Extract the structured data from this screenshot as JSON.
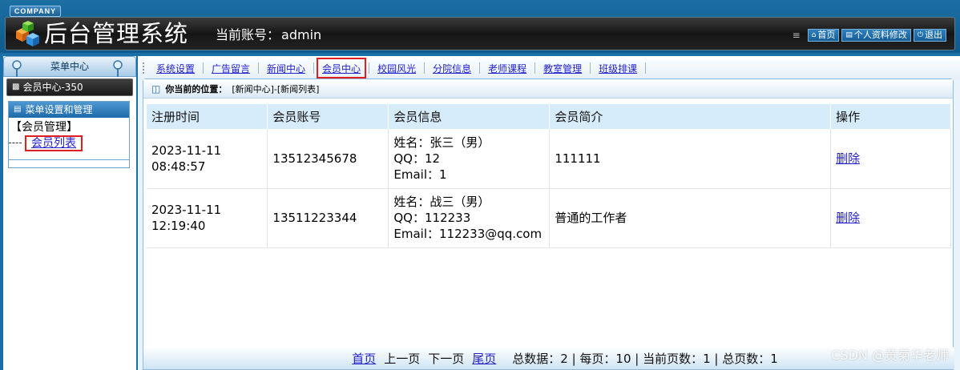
{
  "header": {
    "company": "COMPANY",
    "title": "后台管理系统",
    "account_label": "当前账号：",
    "account_value": "admin",
    "menu": [
      {
        "label": "首页",
        "icon": "home-icon"
      },
      {
        "label": "个人资料修改",
        "icon": "profile-icon"
      },
      {
        "label": "退出",
        "icon": "power-icon"
      }
    ]
  },
  "sidebar": {
    "title": "菜单中心",
    "group": "会员中心-350",
    "box_title": "菜单设置和管理",
    "category": "【会员管理】",
    "link": "会员列表"
  },
  "tabs": [
    {
      "label": "系统设置",
      "active": false
    },
    {
      "label": "广告留言",
      "active": false
    },
    {
      "label": "新闻中心",
      "active": false
    },
    {
      "label": "会员中心",
      "active": true
    },
    {
      "label": "校园风光",
      "active": false
    },
    {
      "label": "分院信息",
      "active": false
    },
    {
      "label": "老师课程",
      "active": false
    },
    {
      "label": "教室管理",
      "active": false
    },
    {
      "label": "班级排课",
      "active": false
    }
  ],
  "breadcrumb": {
    "label": "你当前的位置：",
    "path": "[新闻中心]-[新闻列表]"
  },
  "table": {
    "headers": [
      "注册时间",
      "会员账号",
      "会员信息",
      "会员简介",
      "操作"
    ],
    "rows": [
      {
        "date": "2023-11-11",
        "time": "08:48:57",
        "account": "13512345678",
        "info_name": "姓名：张三（男）",
        "info_qq": "QQ：12",
        "info_email": "Email：1",
        "intro": "111111",
        "action": "删除"
      },
      {
        "date": "2023-11-11",
        "time": "12:19:40",
        "account": "13511223344",
        "info_name": "姓名：战三（男）",
        "info_qq": "QQ：112233",
        "info_email": "Email：112233@qq.com",
        "intro": "普通的工作者",
        "action": "删除"
      }
    ]
  },
  "pager": {
    "first": "首页",
    "prev": "上一页",
    "next": "下一页",
    "last": "尾页",
    "stats": "总数据：2 | 每页：10 | 当前页数：1 | 总页数：1"
  },
  "watermark": "CSDN @黄菊华老师",
  "colors": {
    "header_bg": "#1b6fa3",
    "link": "#2222cc",
    "highlight": "#e02020",
    "table_head": "#d7ecfa"
  }
}
